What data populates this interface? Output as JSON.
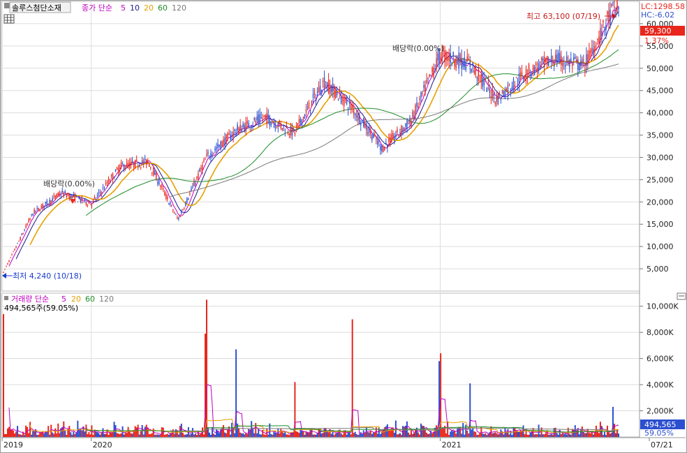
{
  "colors": {
    "up": "#e8261c",
    "down": "#2c4fd0",
    "ma5": "#c000c0",
    "ma10": "#1a1a8c",
    "ma20": "#e6a000",
    "ma60": "#1e8c28",
    "ma120": "#7a7a7a"
  },
  "header": {
    "stock_name": "솔루스첨단소재",
    "price_legend": {
      "prefix": "종가 단순",
      "periods": [
        "5",
        "10",
        "20",
        "60",
        "120"
      ]
    },
    "volume_legend": {
      "prefix": "거래량 단순",
      "periods": [
        "5",
        "20",
        "60",
        "120"
      ]
    },
    "volume_summary": "494,565주(59.05%)"
  },
  "right_info": {
    "lc": "LC:1298.58",
    "hc": "HC:-6.02",
    "price_box": "59,300",
    "pct": "1.37%",
    "vol_box": "494,565",
    "vol_pct": "59.05%"
  },
  "annotations": {
    "high": "최고 63,100 (07/19)",
    "low": "최저 4,240 (10/18)",
    "dividend1": "배당락(0.00%)",
    "dividend2": "배당락(0.00%)"
  },
  "icons": [
    "grid-icon",
    "scroll-icon"
  ],
  "chart_data": [
    {
      "type": "candlestick",
      "title": "솔루스첨단소재",
      "xlabel": "",
      "ylabel": "",
      "ylim": [
        0,
        65000
      ],
      "y_ticks": [
        5000,
        10000,
        15000,
        20000,
        25000,
        30000,
        35000,
        40000,
        45000,
        50000,
        55000,
        60000
      ],
      "y_tick_labels": [
        "5,000",
        "10,000",
        "15,000",
        "20,000",
        "25,000",
        "30,000",
        "35,000",
        "40,000",
        "45,000",
        "50,000",
        "55,000",
        "60,000"
      ],
      "x_labels": [
        "2019",
        "2020",
        "2021",
        "07/21"
      ],
      "x_label_dates": [
        "2019-10",
        "2020-01",
        "2021-01",
        "2021-07-21"
      ],
      "price_path": [
        [
          "2019-10",
          4240
        ],
        [
          "2019-11",
          17500
        ],
        [
          "2019-12",
          22000
        ],
        [
          "2020-01",
          19500
        ],
        [
          "2020-02",
          28000
        ],
        [
          "2020-03",
          29000
        ],
        [
          "2020-04",
          16000
        ],
        [
          "2020-05",
          30000
        ],
        [
          "2020-06",
          36000
        ],
        [
          "2020-07",
          39000
        ],
        [
          "2020-08",
          35500
        ],
        [
          "2020-09",
          47000
        ],
        [
          "2020-10",
          41000
        ],
        [
          "2020-11",
          32000
        ],
        [
          "2020-12",
          38000
        ],
        [
          "2021-01",
          53000
        ],
        [
          "2021-02",
          51000
        ],
        [
          "2021-03",
          43000
        ],
        [
          "2021-04",
          49000
        ],
        [
          "2021-05",
          52000
        ],
        [
          "2021-06",
          50500
        ],
        [
          "2021-07",
          63100
        ]
      ],
      "series": [
        {
          "name": "5",
          "values": []
        },
        {
          "name": "10",
          "values": []
        },
        {
          "name": "20",
          "values": []
        },
        {
          "name": "60",
          "values": []
        },
        {
          "name": "120",
          "values": []
        }
      ],
      "grid": true
    },
    {
      "type": "bar",
      "ylim": [
        0,
        11000000
      ],
      "y_ticks": [
        2000000,
        4000000,
        6000000,
        8000000,
        10000000
      ],
      "y_tick_labels": [
        "2,000K",
        "4,000K",
        "6,000K",
        "8,000K",
        "10,000K"
      ],
      "volume_spikes": [
        [
          "2019-10",
          9400000
        ],
        [
          "2020-05",
          10500000
        ],
        [
          "2020-05",
          7900000
        ],
        [
          "2020-06",
          6700000
        ],
        [
          "2020-08",
          4200000
        ],
        [
          "2020-10",
          9000000
        ],
        [
          "2021-01",
          6400000
        ],
        [
          "2021-01",
          5800000
        ],
        [
          "2021-02",
          4100000
        ],
        [
          "2021-07",
          2300000
        ]
      ],
      "grid": true
    }
  ]
}
